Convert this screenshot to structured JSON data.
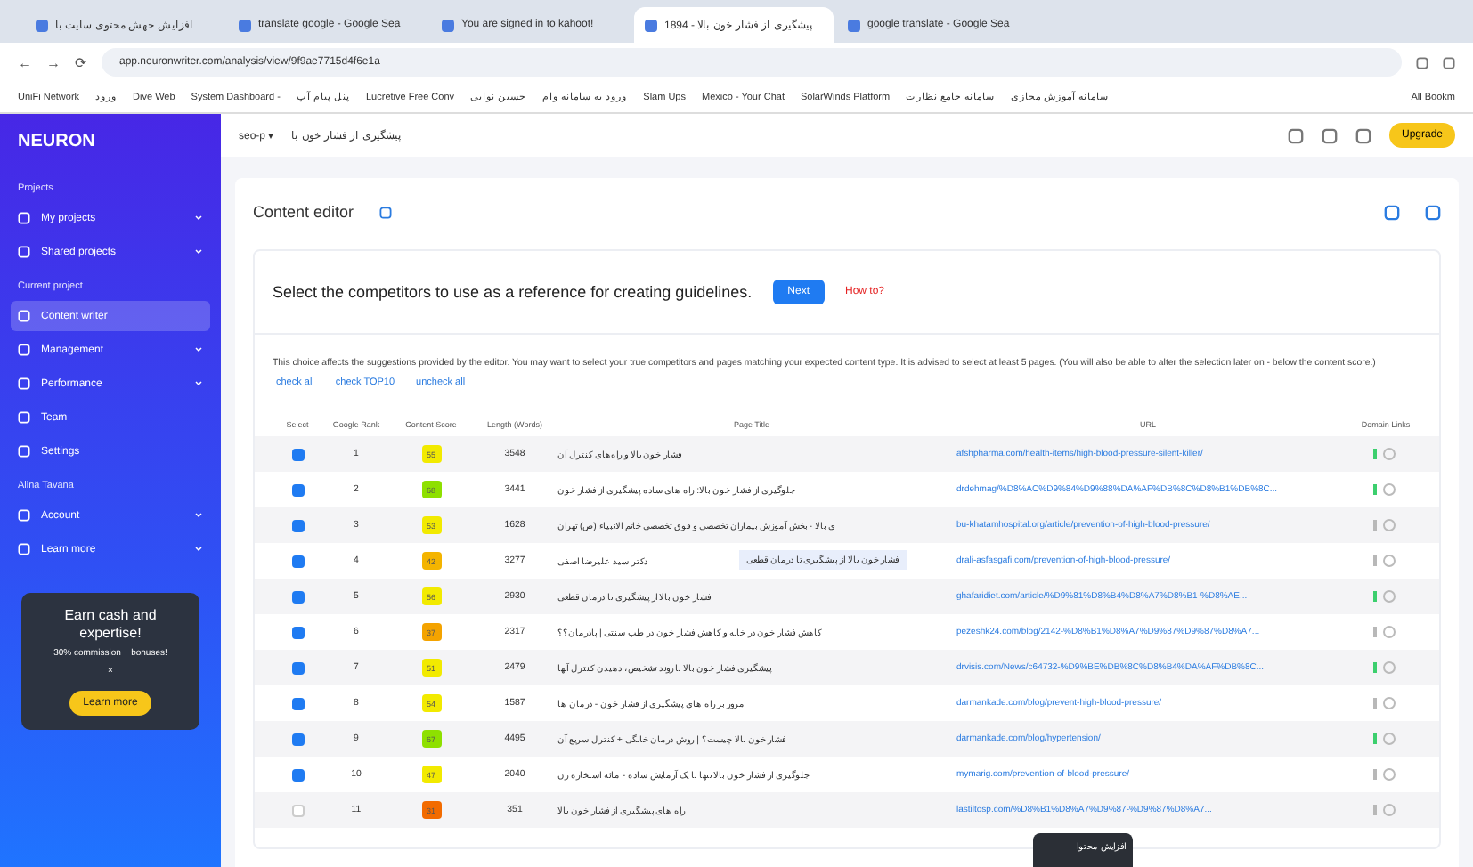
{
  "browser": {
    "tabs": [
      {
        "title": "افزایش جهش محتوی سایت با",
        "selected": false
      },
      {
        "title": "translate google - Google Sea",
        "selected": false
      },
      {
        "title": "You are signed in to kahoot!",
        "selected": false
      },
      {
        "title": "پیشگیری از فشار خون بالا - 1894",
        "selected": true
      },
      {
        "title": "google translate - Google Sea",
        "selected": false
      }
    ],
    "nav": {
      "back": "←",
      "forward": "→",
      "reload": "⟳"
    },
    "url": "app.neuronwriter.com/analysis/view/9f9ae7715d4f6e1a",
    "bookmarks": [
      "UniFi Network",
      "ورود",
      "Dive Web",
      "System Dashboard -",
      "پنل پیام آپ",
      "Lucretive Free Conv",
      "حسین نوایی",
      "ورود به سامانه وام",
      "Slam Ups",
      "Mexico - Your Chat",
      "SolarWinds Platform",
      "سامانه جامع نظارت",
      "سامانه آموزش مجازی"
    ],
    "all_bookmarks": "All Bookm"
  },
  "sidebar": {
    "logo": "NEURON",
    "sections": [
      {
        "title": "Projects",
        "items": [
          {
            "label": "My projects",
            "selected": false,
            "expandable": true
          },
          {
            "label": "Shared projects",
            "selected": false,
            "expandable": true
          }
        ]
      },
      {
        "title": "Current project",
        "items": [
          {
            "label": "Content writer",
            "selected": true,
            "expandable": false
          },
          {
            "label": "Management",
            "selected": false,
            "expandable": true
          },
          {
            "label": "Performance",
            "selected": false,
            "expandable": true
          },
          {
            "label": "Team",
            "selected": false,
            "expandable": false
          },
          {
            "label": "Settings",
            "selected": false,
            "expandable": false
          }
        ]
      },
      {
        "title": "Alina Tavana",
        "items": [
          {
            "label": "Account",
            "selected": false,
            "expandable": true
          },
          {
            "label": "Learn more",
            "selected": false,
            "expandable": true
          }
        ]
      }
    ],
    "promo": {
      "title": "Earn cash and expertise!",
      "subtitle": "30% commission + bonuses!",
      "close": "×",
      "button": "Learn more"
    }
  },
  "topbar": {
    "project": "seo-p",
    "caret": "▾",
    "query": "پیشگیری از فشار خون با",
    "upgrade": "Upgrade"
  },
  "editor": {
    "title": "Content editor",
    "heading": "Select the competitors to use as a reference for creating guidelines.",
    "next": "Next",
    "how": "How to?",
    "description": "This choice affects the suggestions provided by the editor. You may want to select your true competitors and pages matching your expected content type. It is advised to select at least 5 pages. (You will also be able to alter the selection later on - below the content score.)",
    "actions": [
      "check all",
      "check TOP10",
      "uncheck all"
    ],
    "columns": [
      "Select",
      "Google Rank",
      "Content Score",
      "Length (Words)",
      "Page Title",
      "URL",
      "Domain Links"
    ],
    "rows": [
      {
        "selected": true,
        "rank": "1",
        "score": "55",
        "color": "#f2ea00",
        "length": "3548",
        "title": "فشار خون بالا و راه‌های کنترل آن",
        "url": "afshpharma.com/health-items/high-blood-pressure-silent-killer/",
        "linked": true
      },
      {
        "selected": true,
        "rank": "2",
        "score": "68",
        "color": "#8ee000",
        "length": "3441",
        "title": "جلوگیری از فشار خون بالا: راه های ساده پیشگیری از فشار خون",
        "url": "drdehmag/%D8%AC%D9%84%D9%88%DA%AF%DB%8C%D8%B1%DB%8C...",
        "linked": true
      },
      {
        "selected": true,
        "rank": "3",
        "score": "53",
        "color": "#f2ea00",
        "length": "1628",
        "title": "ی بالا - بخش آموزش بیماران تخصصی و فوق تخصصی خاتم الانبیاء (ص) تهران",
        "url": "bu-khatamhospital.org/article/prevention-of-high-blood-pressure/",
        "linked": false
      },
      {
        "selected": true,
        "rank": "4",
        "score": "42",
        "color": "#f4b400",
        "length": "3277",
        "title": "دکتر سید علیرضا اصفی",
        "url": "drali-asfasgafi.com/prevention-of-high-blood-pressure/",
        "linked": false,
        "tooltip": "فشار خون بالا از پیشگیری تا درمان قطعی"
      },
      {
        "selected": true,
        "rank": "5",
        "score": "56",
        "color": "#f2ea00",
        "length": "2930",
        "title": "فشار خون بالا از پیشگیری تا درمان قطعی",
        "url": "ghafaridiet.com/article/%D9%81%D8%B4%D8%A7%D8%B1-%D8%AE...",
        "linked": true
      },
      {
        "selected": true,
        "rank": "6",
        "score": "37",
        "color": "#f4a300",
        "length": "2317",
        "title": "کاهش فشار خون در خانه و کاهش فشار خون در طب سنتی | پادرمان؟؟",
        "url": "pezeshk24.com/blog/2142-%D8%B1%D8%A7%D9%87%D9%87%D8%A7...",
        "linked": false
      },
      {
        "selected": true,
        "rank": "7",
        "score": "51",
        "color": "#f2ea00",
        "length": "2479",
        "title": "پیشگیری فشار خون بالا با روند تشخیص، دهیدن کنترل آنها",
        "url": "drvisis.com/News/c64732-%D9%BE%DB%8C%D8%B4%DA%AF%DB%8C...",
        "linked": true
      },
      {
        "selected": true,
        "rank": "8",
        "score": "54",
        "color": "#f2ea00",
        "length": "1587",
        "title": "مرور بر راه های پیشگیری از فشار خون - درمان ها",
        "url": "darmankade.com/blog/prevent-high-blood-pressure/",
        "linked": false
      },
      {
        "selected": true,
        "rank": "9",
        "score": "67",
        "color": "#8ee000",
        "length": "4495",
        "title": "فشار خون بالا چیست؟ | روش درمان خانگی + کنترل سریع آن",
        "url": "darmankade.com/blog/hypertension/",
        "linked": true
      },
      {
        "selected": true,
        "rank": "10",
        "score": "47",
        "color": "#f2ea00",
        "length": "2040",
        "title": "جلوگیری از فشار خون بالا تنها با یک آزمایش ساده - مائه استخاره زن",
        "url": "mymarig.com/prevention-of-blood-pressure/",
        "linked": false
      },
      {
        "selected": false,
        "rank": "11",
        "score": "31",
        "color": "#f26b00",
        "length": "351",
        "title": "راه های پیشگیری از فشار خون بالا",
        "url": "lastiltosp.com/%D8%B1%D8%A7%D9%87-%D9%87%D8%A7...",
        "linked": false
      }
    ]
  },
  "taskbar_preview": {
    "title": "افزایش محتوا"
  }
}
